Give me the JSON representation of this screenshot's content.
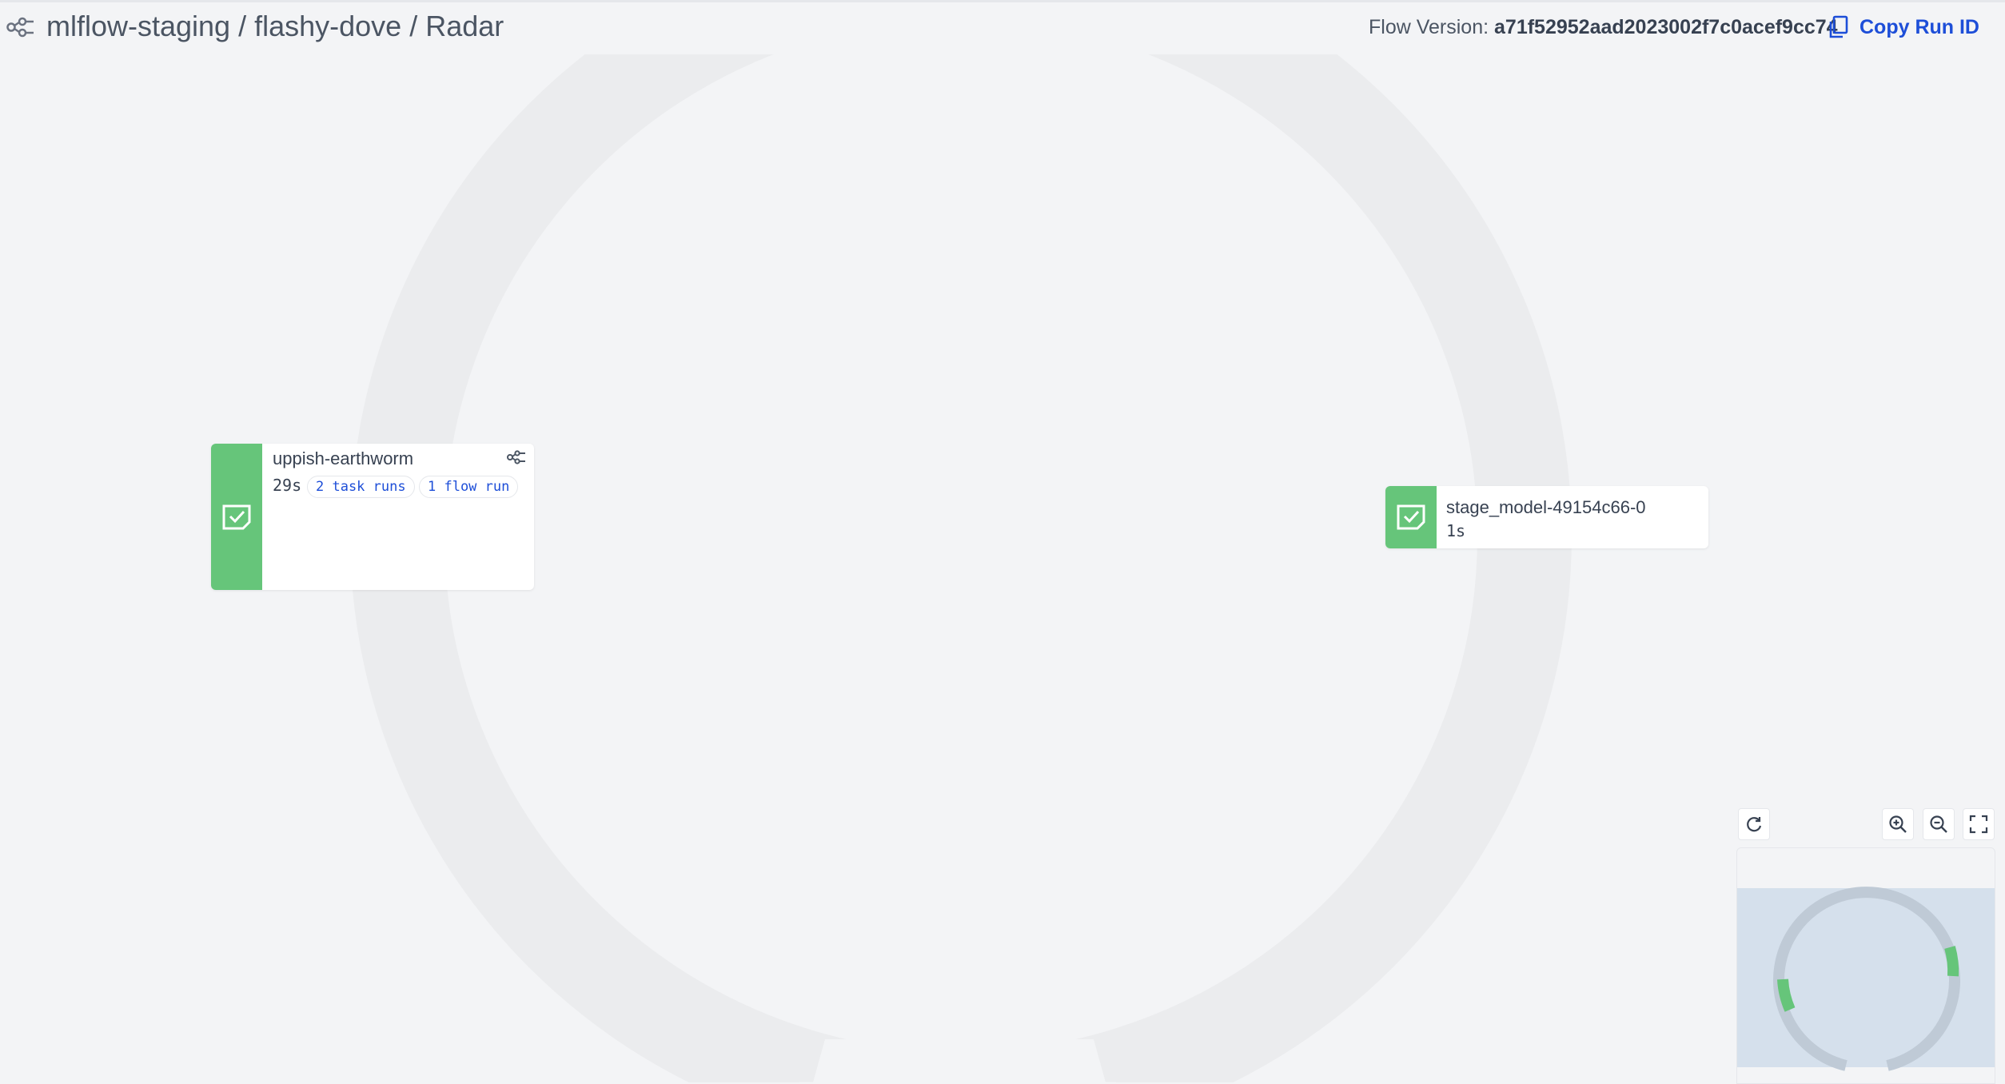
{
  "header": {
    "breadcrumb": [
      "mlflow-staging",
      "flashy-dove",
      "Radar"
    ],
    "separator": "/",
    "flow_version_label": "Flow Version:",
    "flow_version_value": "a71f52952aad2023002f7c0acef9cc74",
    "copy_run_id_label": "Copy Run ID"
  },
  "nodes": [
    {
      "name": "uppish-earthworm",
      "duration": "29s",
      "task_runs": "2 task runs",
      "flow_runs": "1 flow run",
      "state_color": "#66c57a"
    },
    {
      "name": "stage_model-49154c66-0",
      "duration": "1s",
      "state_color": "#66c57a"
    }
  ],
  "controls": {
    "icons": [
      "refresh-icon",
      "zoom-in-icon",
      "zoom-out-icon",
      "fullscreen-icon"
    ]
  },
  "colors": {
    "background": "#f3f4f6",
    "ring": "#ebecee",
    "completed": "#66c57a",
    "link": "#1d4ed8"
  }
}
